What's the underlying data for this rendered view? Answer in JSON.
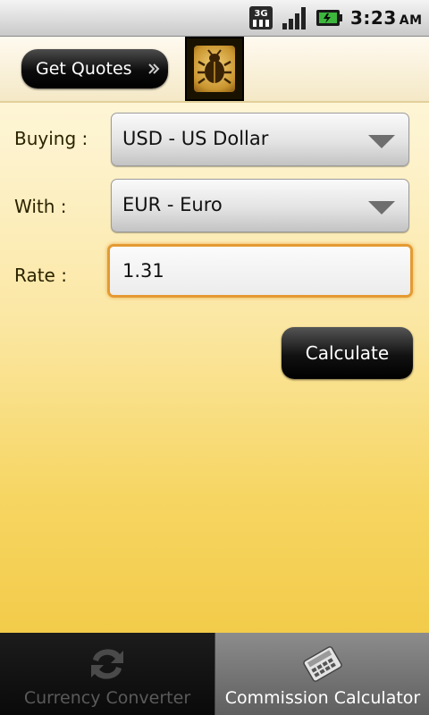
{
  "status_bar": {
    "network_badge": "3G",
    "time": "3:23",
    "ampm": "AM",
    "icons": [
      "3g-icon",
      "signal-icon",
      "battery-icon"
    ]
  },
  "toolbar": {
    "get_quotes_label": "Get Quotes",
    "get_quotes_icon": "double-chevron-right-icon",
    "logo_icon": "beetle-logo-icon"
  },
  "form": {
    "buying_label": "Buying :",
    "buying_value": "USD - US Dollar",
    "with_label": "With :",
    "with_value": "EUR - Euro",
    "rate_label": "Rate :",
    "rate_value": "1.31",
    "calculate_label": "Calculate"
  },
  "tabs": [
    {
      "label": "Currency Converter",
      "icon": "exchange-arrows-icon",
      "selected": false
    },
    {
      "label": "Commission Calculator",
      "icon": "calculator-icon",
      "selected": true
    }
  ],
  "colors": {
    "background_top": "#fffbe6",
    "background_bottom": "#f0c53b",
    "input_focus_border": "#e49a32",
    "tab_selected": "#7a7a7a",
    "tab_unselected": "#101010"
  }
}
